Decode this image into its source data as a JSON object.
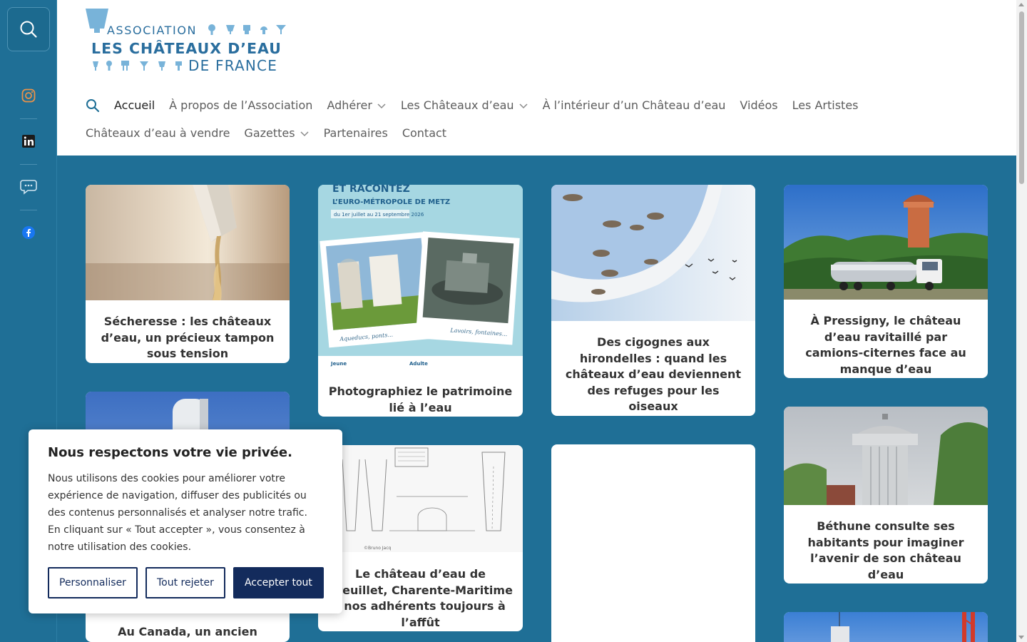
{
  "logo": {
    "line1": "ASSOCIATION",
    "line2": "LES CHÂTEAUX D’EAU",
    "line3": "DE FRANCE"
  },
  "nav": {
    "row1": [
      {
        "label": "Accueil",
        "active": true,
        "dropdown": false
      },
      {
        "label": "À propos de l’Association",
        "active": false,
        "dropdown": false
      },
      {
        "label": "Adhérer",
        "active": false,
        "dropdown": true
      },
      {
        "label": "Les Châteaux d’eau",
        "active": false,
        "dropdown": true
      },
      {
        "label": "À l’intérieur d’un Château d’eau",
        "active": false,
        "dropdown": false
      },
      {
        "label": "Vidéos",
        "active": false,
        "dropdown": false
      },
      {
        "label": "Les Artistes",
        "active": false,
        "dropdown": false
      }
    ],
    "row2": [
      {
        "label": "Châteaux d’eau à vendre",
        "active": false,
        "dropdown": false
      },
      {
        "label": "Gazettes",
        "active": false,
        "dropdown": true
      },
      {
        "label": "Partenaires",
        "active": false,
        "dropdown": false
      },
      {
        "label": "Contact",
        "active": false,
        "dropdown": false
      }
    ]
  },
  "social": {
    "icons": [
      "instagram-icon",
      "linkedin-icon",
      "chat-icon",
      "facebook-icon"
    ]
  },
  "cards": [
    {
      "title": "Sécheresse : les châteaux d’eau, un précieux tampon sous tension"
    },
    {
      "title": "Au Canada, un ancien"
    },
    {
      "title": "Photographiez le patrimoine lié à l’eau",
      "poster_header1": "ET RACONTEZ",
      "poster_header2": "L’EURO-MÉTROPOLE DE METZ",
      "poster_dates": "du 1er juillet au 21 septembre 2026",
      "poster_caption1": "Aqueducs, ponts...",
      "poster_caption2": "Lavoirs, fontaines...",
      "poster_jeune": "Jeune",
      "poster_adulte": "Adulte"
    },
    {
      "title": "Le château d’eau de Breuillet, Charente-Maritime : nos adhérents toujours à l’affût",
      "credit": "©Bruno Jacq"
    },
    {
      "title": "Des cigognes aux hirondelles : quand les châteaux d’eau deviennent des refuges pour les oiseaux"
    },
    {
      "title": ""
    },
    {
      "title": "À Pressigny, le château d’eau ravitaillé par camions-citernes face au manque d’eau"
    },
    {
      "title": "Béthune consulte ses habitants pour imaginer l’avenir de son château d’eau"
    },
    {
      "title": ""
    }
  ],
  "cookie": {
    "title": "Nous respectons votre vie privée.",
    "text": "Nous utilisons des cookies pour améliorer votre expérience de navigation, diffuser des publicités ou des contenus personnalisés et analyser notre trafic. En cliquant sur « Tout accepter », vous consentez à notre utilisation des cookies.",
    "btn_customize": "Personnaliser",
    "btn_reject": "Tout rejeter",
    "btn_accept": "Accepter tout"
  },
  "colors": {
    "brand_blue": "#1f6f96",
    "logo_blue": "#2a6e9e",
    "logo_light": "#78b3d9",
    "cookie_navy": "#132b5c"
  }
}
